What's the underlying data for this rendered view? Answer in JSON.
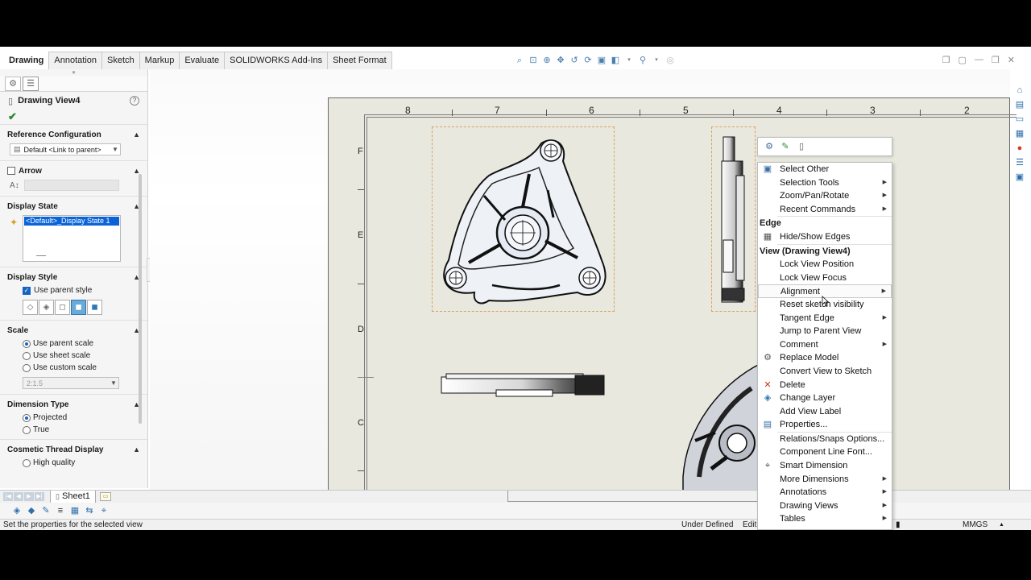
{
  "tabs": [
    "Drawing",
    "Annotation",
    "Sketch",
    "Markup",
    "Evaluate",
    "SOLIDWORKS Add-Ins",
    "Sheet Format"
  ],
  "active_tab": "Drawing",
  "property_manager": {
    "title": "Drawing View4",
    "reference_configuration": {
      "title": "Reference Configuration",
      "value": "Default <Link to parent>"
    },
    "arrow": {
      "title": "Arrow"
    },
    "display_state": {
      "title": "Display State",
      "selected": "<Default>_Display State 1"
    },
    "display_style": {
      "title": "Display Style",
      "use_parent_style": "Use parent style"
    },
    "scale": {
      "title": "Scale",
      "options": [
        "Use parent scale",
        "Use sheet scale",
        "Use custom scale"
      ],
      "selected_index": 0,
      "custom_value": "2:1.5"
    },
    "dimension_type": {
      "title": "Dimension Type",
      "options": [
        "Projected",
        "True"
      ],
      "selected_index": 0
    },
    "cosmetic_thread": {
      "title": "Cosmetic Thread Display",
      "options": [
        "High quality"
      ]
    }
  },
  "sheet": {
    "columns": [
      "8",
      "7",
      "6",
      "5",
      "4",
      "3",
      "2"
    ],
    "rows": [
      "F",
      "E",
      "D",
      "C"
    ]
  },
  "sheet_tab": "Sheet1",
  "status": {
    "message": "Set the properties for the selected view",
    "state": "Under Defined",
    "editing": "Edit",
    "units": "MMGS"
  },
  "context_menu": {
    "items_top": [
      {
        "label": "Select Other",
        "icon": "select-other-icon",
        "submenu": false
      },
      {
        "label": "Selection Tools",
        "icon": "",
        "submenu": true
      },
      {
        "label": "Zoom/Pan/Rotate",
        "icon": "",
        "submenu": true
      },
      {
        "label": "Recent Commands",
        "icon": "",
        "submenu": true
      }
    ],
    "header_edge": "Edge",
    "items_edge": [
      {
        "label": "Hide/Show Edges",
        "icon": "hide-show-edges-icon",
        "submenu": false
      }
    ],
    "header_view": "View (Drawing View4)",
    "items_view": [
      {
        "label": "Lock View Position",
        "icon": "",
        "submenu": false
      },
      {
        "label": "Lock View Focus",
        "icon": "",
        "submenu": false
      },
      {
        "label": "Alignment",
        "icon": "",
        "submenu": true,
        "highlight": true
      },
      {
        "label": "Reset sketch visibility",
        "icon": "",
        "submenu": false
      },
      {
        "label": "Tangent Edge",
        "icon": "",
        "submenu": true
      },
      {
        "label": "Jump to Parent View",
        "icon": "",
        "submenu": false
      },
      {
        "label": "Comment",
        "icon": "",
        "submenu": true
      },
      {
        "label": "Replace Model",
        "icon": "replace-model-icon",
        "submenu": false
      },
      {
        "label": "Convert View to Sketch",
        "icon": "",
        "submenu": false
      },
      {
        "label": "Delete",
        "icon": "delete-icon",
        "submenu": false
      },
      {
        "label": "Change Layer",
        "icon": "change-layer-icon",
        "submenu": false
      },
      {
        "label": "Add View Label",
        "icon": "",
        "submenu": false
      },
      {
        "label": "Properties...",
        "icon": "properties-icon",
        "submenu": false
      }
    ],
    "items_bottom": [
      {
        "label": "Relations/Snaps Options...",
        "icon": "",
        "submenu": false
      },
      {
        "label": "Component Line Font...",
        "icon": "",
        "submenu": false
      },
      {
        "label": "Smart Dimension",
        "icon": "smart-dimension-icon",
        "submenu": false
      },
      {
        "label": "More Dimensions",
        "icon": "",
        "submenu": true
      },
      {
        "label": "Annotations",
        "icon": "",
        "submenu": true
      },
      {
        "label": "Drawing Views",
        "icon": "",
        "submenu": true
      },
      {
        "label": "Tables",
        "icon": "",
        "submenu": true
      }
    ]
  }
}
